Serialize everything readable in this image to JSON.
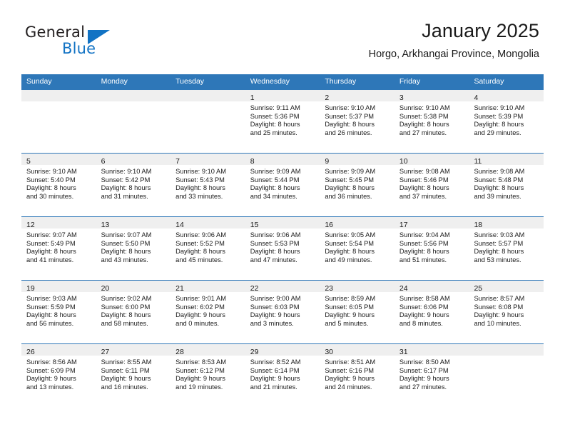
{
  "brand": {
    "name_top": "General",
    "name_bottom": "Blue"
  },
  "header": {
    "title": "January 2025",
    "subtitle": "Horgo, Arkhangai Province, Mongolia"
  },
  "colors": {
    "header_blue": "#2e77b8",
    "logo_blue": "#1273c4",
    "datebar_gray": "#efefef"
  },
  "weekdays": [
    "Sunday",
    "Monday",
    "Tuesday",
    "Wednesday",
    "Thursday",
    "Friday",
    "Saturday"
  ],
  "weeks": [
    [
      {
        "date": "",
        "lines": []
      },
      {
        "date": "",
        "lines": []
      },
      {
        "date": "",
        "lines": []
      },
      {
        "date": "1",
        "lines": [
          "Sunrise: 9:11 AM",
          "Sunset: 5:36 PM",
          "Daylight: 8 hours",
          "and 25 minutes."
        ]
      },
      {
        "date": "2",
        "lines": [
          "Sunrise: 9:10 AM",
          "Sunset: 5:37 PM",
          "Daylight: 8 hours",
          "and 26 minutes."
        ]
      },
      {
        "date": "3",
        "lines": [
          "Sunrise: 9:10 AM",
          "Sunset: 5:38 PM",
          "Daylight: 8 hours",
          "and 27 minutes."
        ]
      },
      {
        "date": "4",
        "lines": [
          "Sunrise: 9:10 AM",
          "Sunset: 5:39 PM",
          "Daylight: 8 hours",
          "and 29 minutes."
        ]
      }
    ],
    [
      {
        "date": "5",
        "lines": [
          "Sunrise: 9:10 AM",
          "Sunset: 5:40 PM",
          "Daylight: 8 hours",
          "and 30 minutes."
        ]
      },
      {
        "date": "6",
        "lines": [
          "Sunrise: 9:10 AM",
          "Sunset: 5:42 PM",
          "Daylight: 8 hours",
          "and 31 minutes."
        ]
      },
      {
        "date": "7",
        "lines": [
          "Sunrise: 9:10 AM",
          "Sunset: 5:43 PM",
          "Daylight: 8 hours",
          "and 33 minutes."
        ]
      },
      {
        "date": "8",
        "lines": [
          "Sunrise: 9:09 AM",
          "Sunset: 5:44 PM",
          "Daylight: 8 hours",
          "and 34 minutes."
        ]
      },
      {
        "date": "9",
        "lines": [
          "Sunrise: 9:09 AM",
          "Sunset: 5:45 PM",
          "Daylight: 8 hours",
          "and 36 minutes."
        ]
      },
      {
        "date": "10",
        "lines": [
          "Sunrise: 9:08 AM",
          "Sunset: 5:46 PM",
          "Daylight: 8 hours",
          "and 37 minutes."
        ]
      },
      {
        "date": "11",
        "lines": [
          "Sunrise: 9:08 AM",
          "Sunset: 5:48 PM",
          "Daylight: 8 hours",
          "and 39 minutes."
        ]
      }
    ],
    [
      {
        "date": "12",
        "lines": [
          "Sunrise: 9:07 AM",
          "Sunset: 5:49 PM",
          "Daylight: 8 hours",
          "and 41 minutes."
        ]
      },
      {
        "date": "13",
        "lines": [
          "Sunrise: 9:07 AM",
          "Sunset: 5:50 PM",
          "Daylight: 8 hours",
          "and 43 minutes."
        ]
      },
      {
        "date": "14",
        "lines": [
          "Sunrise: 9:06 AM",
          "Sunset: 5:52 PM",
          "Daylight: 8 hours",
          "and 45 minutes."
        ]
      },
      {
        "date": "15",
        "lines": [
          "Sunrise: 9:06 AM",
          "Sunset: 5:53 PM",
          "Daylight: 8 hours",
          "and 47 minutes."
        ]
      },
      {
        "date": "16",
        "lines": [
          "Sunrise: 9:05 AM",
          "Sunset: 5:54 PM",
          "Daylight: 8 hours",
          "and 49 minutes."
        ]
      },
      {
        "date": "17",
        "lines": [
          "Sunrise: 9:04 AM",
          "Sunset: 5:56 PM",
          "Daylight: 8 hours",
          "and 51 minutes."
        ]
      },
      {
        "date": "18",
        "lines": [
          "Sunrise: 9:03 AM",
          "Sunset: 5:57 PM",
          "Daylight: 8 hours",
          "and 53 minutes."
        ]
      }
    ],
    [
      {
        "date": "19",
        "lines": [
          "Sunrise: 9:03 AM",
          "Sunset: 5:59 PM",
          "Daylight: 8 hours",
          "and 56 minutes."
        ]
      },
      {
        "date": "20",
        "lines": [
          "Sunrise: 9:02 AM",
          "Sunset: 6:00 PM",
          "Daylight: 8 hours",
          "and 58 minutes."
        ]
      },
      {
        "date": "21",
        "lines": [
          "Sunrise: 9:01 AM",
          "Sunset: 6:02 PM",
          "Daylight: 9 hours",
          "and 0 minutes."
        ]
      },
      {
        "date": "22",
        "lines": [
          "Sunrise: 9:00 AM",
          "Sunset: 6:03 PM",
          "Daylight: 9 hours",
          "and 3 minutes."
        ]
      },
      {
        "date": "23",
        "lines": [
          "Sunrise: 8:59 AM",
          "Sunset: 6:05 PM",
          "Daylight: 9 hours",
          "and 5 minutes."
        ]
      },
      {
        "date": "24",
        "lines": [
          "Sunrise: 8:58 AM",
          "Sunset: 6:06 PM",
          "Daylight: 9 hours",
          "and 8 minutes."
        ]
      },
      {
        "date": "25",
        "lines": [
          "Sunrise: 8:57 AM",
          "Sunset: 6:08 PM",
          "Daylight: 9 hours",
          "and 10 minutes."
        ]
      }
    ],
    [
      {
        "date": "26",
        "lines": [
          "Sunrise: 8:56 AM",
          "Sunset: 6:09 PM",
          "Daylight: 9 hours",
          "and 13 minutes."
        ]
      },
      {
        "date": "27",
        "lines": [
          "Sunrise: 8:55 AM",
          "Sunset: 6:11 PM",
          "Daylight: 9 hours",
          "and 16 minutes."
        ]
      },
      {
        "date": "28",
        "lines": [
          "Sunrise: 8:53 AM",
          "Sunset: 6:12 PM",
          "Daylight: 9 hours",
          "and 19 minutes."
        ]
      },
      {
        "date": "29",
        "lines": [
          "Sunrise: 8:52 AM",
          "Sunset: 6:14 PM",
          "Daylight: 9 hours",
          "and 21 minutes."
        ]
      },
      {
        "date": "30",
        "lines": [
          "Sunrise: 8:51 AM",
          "Sunset: 6:16 PM",
          "Daylight: 9 hours",
          "and 24 minutes."
        ]
      },
      {
        "date": "31",
        "lines": [
          "Sunrise: 8:50 AM",
          "Sunset: 6:17 PM",
          "Daylight: 9 hours",
          "and 27 minutes."
        ]
      },
      {
        "date": "",
        "lines": []
      }
    ]
  ]
}
